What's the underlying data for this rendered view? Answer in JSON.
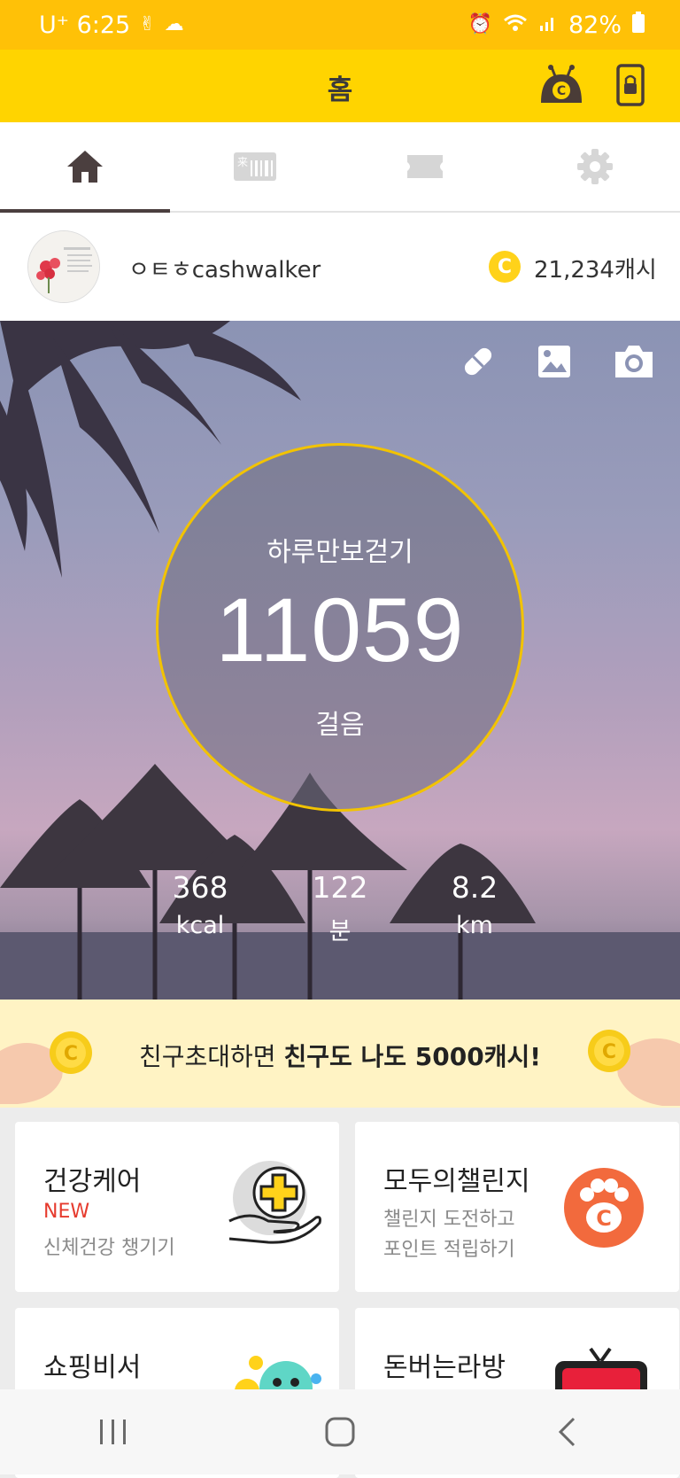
{
  "status_bar": {
    "carrier_time": "U⁺ 6:25",
    "battery": "82%"
  },
  "app_bar": {
    "title": "홈"
  },
  "tabs": [
    {
      "icon": "home-icon",
      "active": true
    },
    {
      "icon": "barcode-icon",
      "active": false
    },
    {
      "icon": "ticket-icon",
      "active": false
    },
    {
      "icon": "gear-icon",
      "active": false
    }
  ],
  "profile": {
    "username": "ㅇㅌㅎcashwalker",
    "coin_symbol": "C",
    "cash": "21,234캐시"
  },
  "hero": {
    "icons": [
      "pill-icon",
      "image-icon",
      "camera-icon"
    ],
    "step_label": "하루만보걷기",
    "step_count": "11059",
    "step_unit": "걸음",
    "stats": [
      {
        "value": "368",
        "unit": "kcal"
      },
      {
        "value": "122",
        "unit": "분"
      },
      {
        "value": "8.2",
        "unit": "km"
      }
    ]
  },
  "banner": {
    "text_plain": "친구초대하면 ",
    "text_bold": "친구도 나도 5000캐시!"
  },
  "cards": [
    {
      "title": "건강케어",
      "badge": "NEW",
      "subtitle": "신체건강 챙기기",
      "icon": "health-care-icon"
    },
    {
      "title": "모두의챌린지",
      "subtitle_1": "챌린지 도전하고",
      "subtitle_2": "포인트 적립하기",
      "icon": "paw-icon"
    },
    {
      "title": "쇼핑비서",
      "icon": "shopping-assistant-icon"
    },
    {
      "title": "돈버는라방",
      "icon": "tv-icon"
    }
  ],
  "colors": {
    "status_bar": "#ffc107",
    "app_bar": "#ffd400",
    "accent": "#f2c300",
    "badge_new": "#e63b2e"
  }
}
